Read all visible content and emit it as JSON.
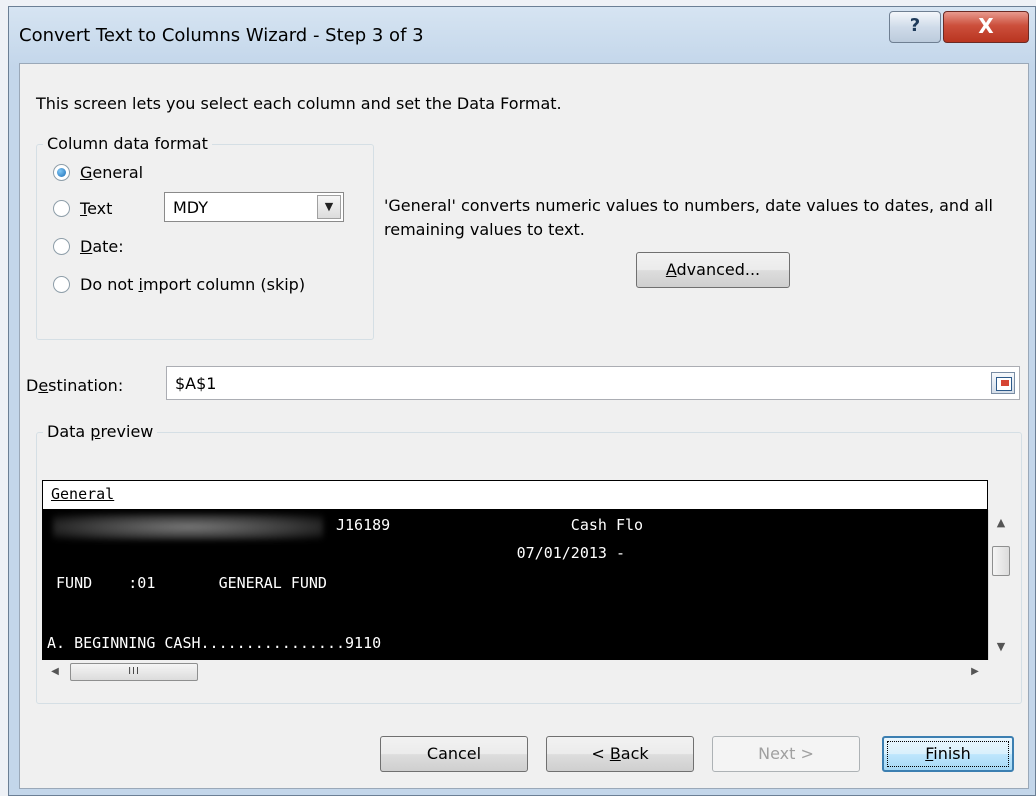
{
  "window": {
    "title": "Convert Text to Columns Wizard - Step 3 of 3",
    "help_label": "?",
    "close_label": "X"
  },
  "intro_text": "This screen lets you select each column and set the Data Format.",
  "column_format": {
    "group_label": "Column data format",
    "options": [
      {
        "prefix": "",
        "accel": "G",
        "suffix": "eneral",
        "checked": true
      },
      {
        "prefix": "",
        "accel": "T",
        "suffix": "ext",
        "checked": false
      },
      {
        "prefix": "",
        "accel": "D",
        "suffix": "ate:",
        "checked": false
      },
      {
        "prefix": "Do not ",
        "accel": "i",
        "suffix": "mport column (skip)",
        "checked": false
      }
    ],
    "date_value": "MDY"
  },
  "description": "'General' converts numeric values to numbers, date values to dates, and all remaining values to text.",
  "advanced_button": {
    "accel": "A",
    "rest": "dvanced..."
  },
  "destination": {
    "label_prefix": "D",
    "label_accel": "e",
    "label_suffix": "stination:",
    "value": "$A$1"
  },
  "preview": {
    "group_prefix": "Data ",
    "group_accel": "p",
    "group_suffix": "review",
    "column_header": "General",
    "rows": [
      "                                J16189                    Cash Flo",
      "                                                    07/01/2013 -",
      " FUND    :01       GENERAL FUND",
      "",
      "A. BEGINNING CASH................9110"
    ],
    "hscroll_thumb_label": "III"
  },
  "buttons": {
    "cancel": "Cancel",
    "back_prefix": "< ",
    "back_accel": "B",
    "back_suffix": "ack",
    "next": "Next >",
    "finish_accel": "F",
    "finish_suffix": "inish"
  }
}
